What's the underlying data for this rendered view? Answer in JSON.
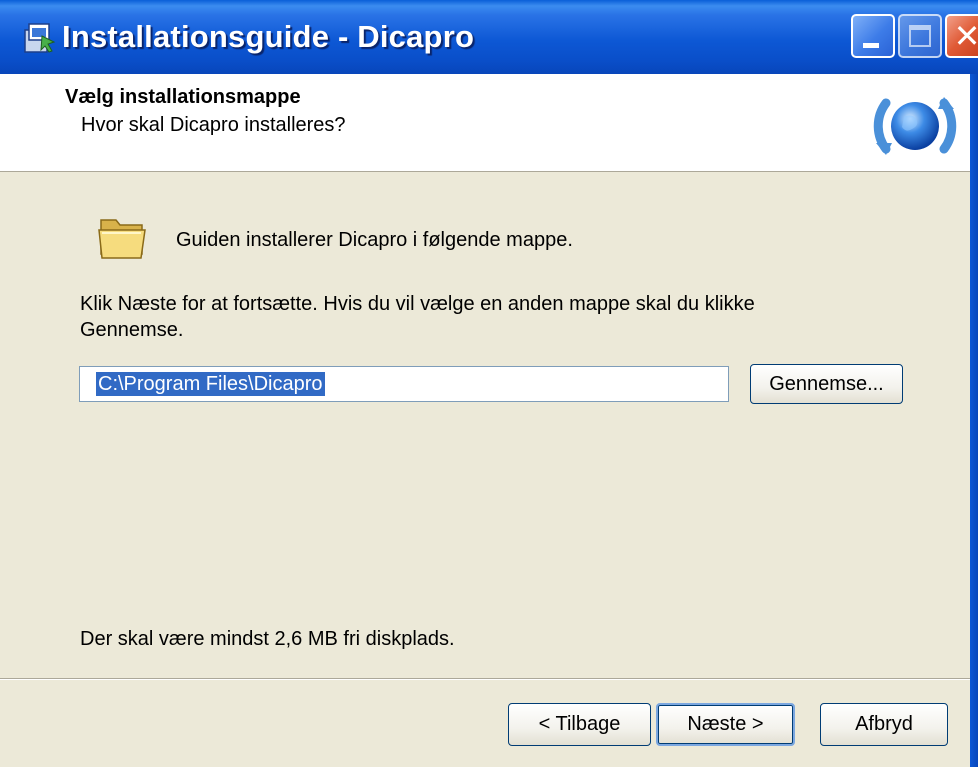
{
  "window": {
    "title": "Installationsguide - Dicapro",
    "close_glyph": "✕"
  },
  "header": {
    "title": "Vælg installationsmappe",
    "subtitle": "Hvor skal Dicapro installeres?"
  },
  "body": {
    "intro": "Guiden installerer Dicapro i følgende mappe.",
    "instructions": "Klik Næste for at fortsætte. Hvis du vil vælge en anden mappe skal du klikke Gennemse.",
    "path_value": "C:\\Program Files\\Dicapro",
    "browse_label": "Gennemse...",
    "disk_space": "Der skal være mindst 2,6 MB fri diskplads."
  },
  "footer": {
    "back_label": "< Tilbage",
    "next_label": "Næste >",
    "cancel_label": "Afbryd"
  },
  "icons": {
    "title": "installer-app-icon",
    "header": "globe-setup-icon",
    "folder": "folder-icon"
  },
  "colors": {
    "titlebar": "#0a4fca",
    "dialog_bg": "#ece9d8",
    "selection": "#316ac5",
    "button_border": "#003c74"
  }
}
